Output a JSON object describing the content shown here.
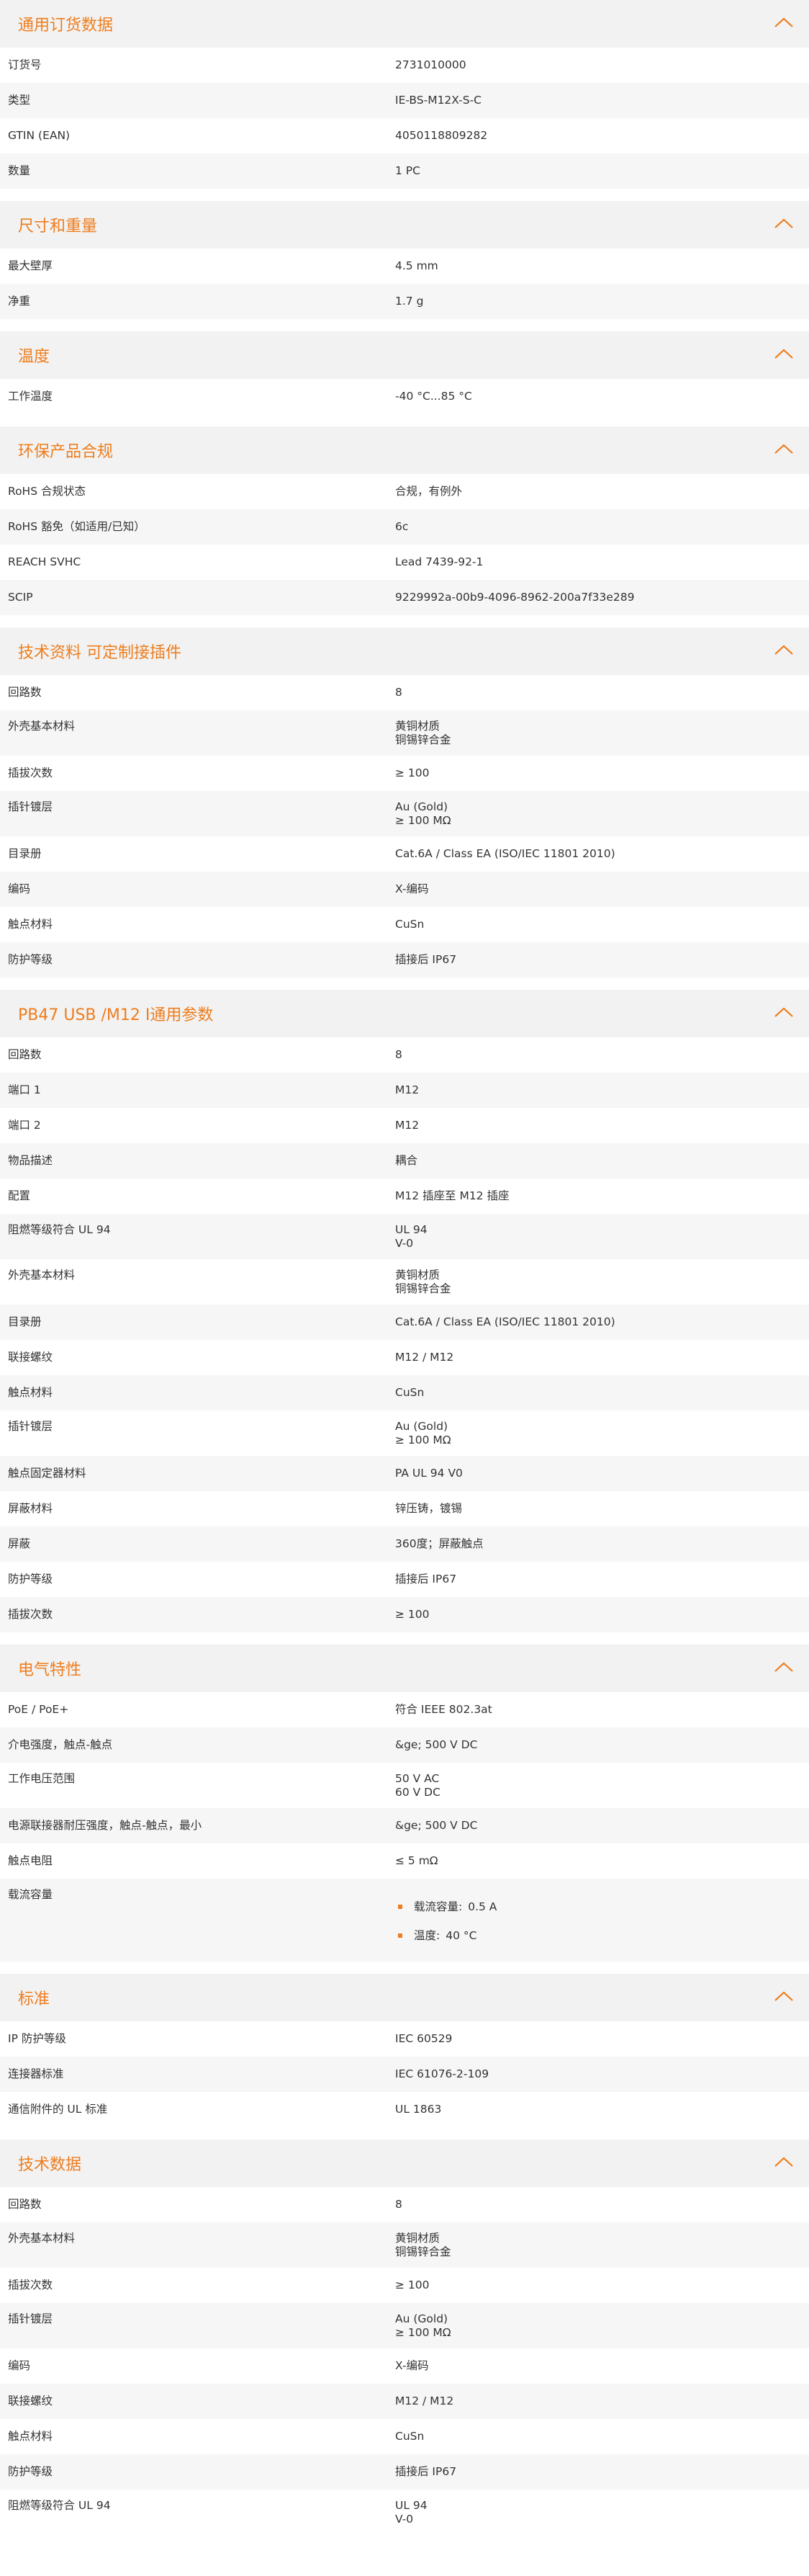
{
  "colors": {
    "accent": "#ee7d1e",
    "header_bg": "#f2f2f2",
    "row_alt_bg": "#f6f6f6"
  },
  "icons": {
    "collapse": "chevron-up-icon",
    "bullet": "square-bullet-icon"
  },
  "sections": [
    {
      "title": "通用订货数据",
      "rows": [
        {
          "label": "订货号",
          "lines": [
            "2731010000"
          ]
        },
        {
          "label": "类型",
          "lines": [
            "IE-BS-M12X-S-C"
          ]
        },
        {
          "label": "GTIN (EAN)",
          "lines": [
            "4050118809282"
          ]
        },
        {
          "label": "数量",
          "lines": [
            "1  PC"
          ]
        }
      ]
    },
    {
      "title": "尺寸和重量",
      "rows": [
        {
          "label": "最大壁厚",
          "lines": [
            "4.5  mm"
          ]
        },
        {
          "label": "净重",
          "lines": [
            "1.7  g"
          ]
        }
      ]
    },
    {
      "title": "温度",
      "rows": [
        {
          "label": "工作温度",
          "lines": [
            "-40 °C...85 °C"
          ]
        }
      ]
    },
    {
      "title": "环保产品合规",
      "rows": [
        {
          "label": "RoHS 合规状态",
          "lines": [
            "合规，有例外"
          ]
        },
        {
          "label": "RoHS 豁免（如适用/已知）",
          "lines": [
            "6c"
          ]
        },
        {
          "label": "REACH SVHC",
          "lines": [
            "Lead 7439-92-1"
          ]
        },
        {
          "label": "SCIP",
          "lines": [
            "9229992a-00b9-4096-8962-200a7f33e289"
          ]
        }
      ]
    },
    {
      "title": "技术资料 可定制接插件",
      "rows": [
        {
          "label": "回路数",
          "lines": [
            "8"
          ]
        },
        {
          "label": "外壳基本材料",
          "lines": [
            "黄铜材质",
            "铜锡锌合金"
          ]
        },
        {
          "label": "插拔次数",
          "lines": [
            "≥ 100"
          ]
        },
        {
          "label": "插针镀层",
          "lines": [
            "Au (Gold)",
            "≥ 100 MΩ"
          ]
        },
        {
          "label": "目录册",
          "lines": [
            "Cat.6A / Class EA (ISO/IEC 11801 2010)"
          ]
        },
        {
          "label": "编码",
          "lines": [
            "X-编码"
          ]
        },
        {
          "label": "触点材料",
          "lines": [
            "CuSn"
          ]
        },
        {
          "label": "防护等级",
          "lines": [
            "插接后 IP67"
          ]
        }
      ]
    },
    {
      "title": "PB47 USB /M12 I通用参数",
      "rows": [
        {
          "label": "回路数",
          "lines": [
            "8"
          ]
        },
        {
          "label": "端口 1",
          "lines": [
            "M12"
          ]
        },
        {
          "label": "端口 2",
          "lines": [
            "M12"
          ]
        },
        {
          "label": "物品描述",
          "lines": [
            "耦合"
          ]
        },
        {
          "label": "配置",
          "lines": [
            "M12 插座至 M12 插座"
          ]
        },
        {
          "label": "阻燃等级符合 UL 94",
          "lines": [
            "UL 94",
            "V-0"
          ]
        },
        {
          "label": "外壳基本材料",
          "lines": [
            "黄铜材质",
            "铜锡锌合金"
          ]
        },
        {
          "label": "目录册",
          "lines": [
            "Cat.6A / Class EA (ISO/IEC 11801 2010)"
          ]
        },
        {
          "label": "联接螺纹",
          "lines": [
            "M12 / M12"
          ]
        },
        {
          "label": "触点材料",
          "lines": [
            "CuSn"
          ]
        },
        {
          "label": "插针镀层",
          "lines": [
            "Au (Gold)",
            "≥ 100 MΩ"
          ]
        },
        {
          "label": "触点固定器材料",
          "lines": [
            "PA UL 94 V0"
          ]
        },
        {
          "label": "屏蔽材料",
          "lines": [
            "锌压铸，镀锡"
          ]
        },
        {
          "label": "屏蔽",
          "lines": [
            "360度；屏蔽触点"
          ]
        },
        {
          "label": "防护等级",
          "lines": [
            "插接后 IP67"
          ]
        },
        {
          "label": "插拔次数",
          "lines": [
            "≥ 100"
          ]
        }
      ]
    },
    {
      "title": "电气特性",
      "rows": [
        {
          "label": "PoE / PoE+",
          "lines": [
            "符合 IEEE 802.3at"
          ]
        },
        {
          "label": "介电强度，触点-触点",
          "lines": [
            "&ge; 500 V DC"
          ]
        },
        {
          "label": "工作电压范围",
          "lines": [
            "50 V AC",
            "60 V DC"
          ]
        },
        {
          "label": "电源联接器耐压强度，触点-触点，最小",
          "lines": [
            "&ge; 500 V DC"
          ]
        },
        {
          "label": "触点电阻",
          "lines": [
            "≤ 5 mΩ"
          ]
        },
        {
          "label": "载流容量",
          "lines": [],
          "bullets": [
            {
              "label": "载流容量:",
              "value": "0.5 A"
            },
            {
              "label": "温度:",
              "value": "40 °C"
            }
          ]
        }
      ]
    },
    {
      "title": "标准",
      "rows": [
        {
          "label": "IP 防护等级",
          "lines": [
            "IEC 60529"
          ]
        },
        {
          "label": "连接器标准",
          "lines": [
            "IEC 61076-2-109"
          ]
        },
        {
          "label": "通信附件的 UL 标准",
          "lines": [
            "UL 1863"
          ]
        }
      ]
    },
    {
      "title": "技术数据",
      "rows": [
        {
          "label": "回路数",
          "lines": [
            "8"
          ]
        },
        {
          "label": "外壳基本材料",
          "lines": [
            "黄铜材质",
            "铜锡锌合金"
          ]
        },
        {
          "label": "插拔次数",
          "lines": [
            "≥ 100"
          ]
        },
        {
          "label": "插针镀层",
          "lines": [
            "Au (Gold)",
            "≥ 100 MΩ"
          ]
        },
        {
          "label": "编码",
          "lines": [
            "X-编码"
          ]
        },
        {
          "label": "联接螺纹",
          "lines": [
            "M12 / M12"
          ]
        },
        {
          "label": "触点材料",
          "lines": [
            "CuSn"
          ]
        },
        {
          "label": "防护等级",
          "lines": [
            "插接后 IP67"
          ]
        },
        {
          "label": "阻燃等级符合 UL 94",
          "lines": [
            "UL 94",
            "V-0"
          ]
        }
      ]
    }
  ]
}
